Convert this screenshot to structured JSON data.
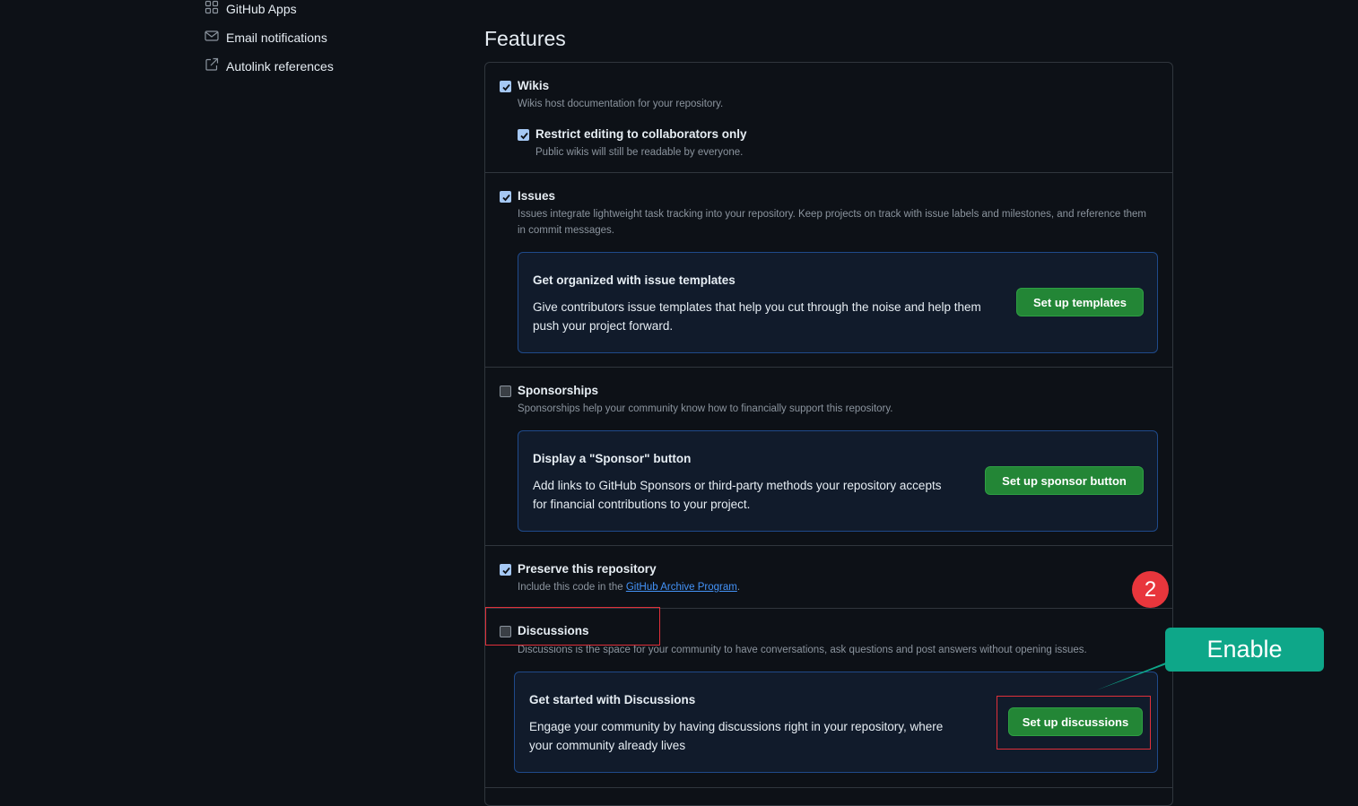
{
  "sidebar": {
    "items": [
      {
        "label": "GitHub Apps",
        "icon": "apps-grid-icon"
      },
      {
        "label": "Email notifications",
        "icon": "mail-icon"
      },
      {
        "label": "Autolink references",
        "icon": "external-link-icon"
      }
    ]
  },
  "features": {
    "title": "Features",
    "wikis": {
      "label": "Wikis",
      "checked": true,
      "description": "Wikis host documentation for your repository.",
      "restrict": {
        "label": "Restrict editing to collaborators only",
        "checked": true,
        "description": "Public wikis will still be readable by everyone."
      }
    },
    "issues": {
      "label": "Issues",
      "checked": true,
      "description": "Issues integrate lightweight task tracking into your repository. Keep projects on track with issue labels and milestones, and reference them in commit messages.",
      "promo": {
        "title": "Get organized with issue templates",
        "body": "Give contributors issue templates that help you cut through the noise and help them push your project forward.",
        "button": "Set up templates"
      }
    },
    "sponsorships": {
      "label": "Sponsorships",
      "checked": false,
      "description": "Sponsorships help your community know how to financially support this repository.",
      "promo": {
        "title": "Display a \"Sponsor\" button",
        "body": "Add links to GitHub Sponsors or third-party methods your repository accepts for financial contributions to your project.",
        "button": "Set up sponsor button"
      }
    },
    "preserve": {
      "label": "Preserve this repository",
      "checked": true,
      "description_prefix": "Include this code in the ",
      "link": "GitHub Archive Program",
      "description_suffix": "."
    },
    "discussions": {
      "label": "Discussions",
      "checked": false,
      "description": "Discussions is the space for your community to have conversations, ask questions and post answers without opening issues.",
      "promo": {
        "title": "Get started with Discussions",
        "body": "Engage your community by having discussions right in your repository, where your community already lives",
        "button": "Set up discussions"
      }
    }
  },
  "annotations": {
    "step_number": "2",
    "callout": "Enable",
    "accent_red": "#e8363c",
    "accent_teal": "#0ea789"
  },
  "colors": {
    "background": "#0d1117",
    "primary_button": "#238636",
    "link": "#4493f8"
  }
}
